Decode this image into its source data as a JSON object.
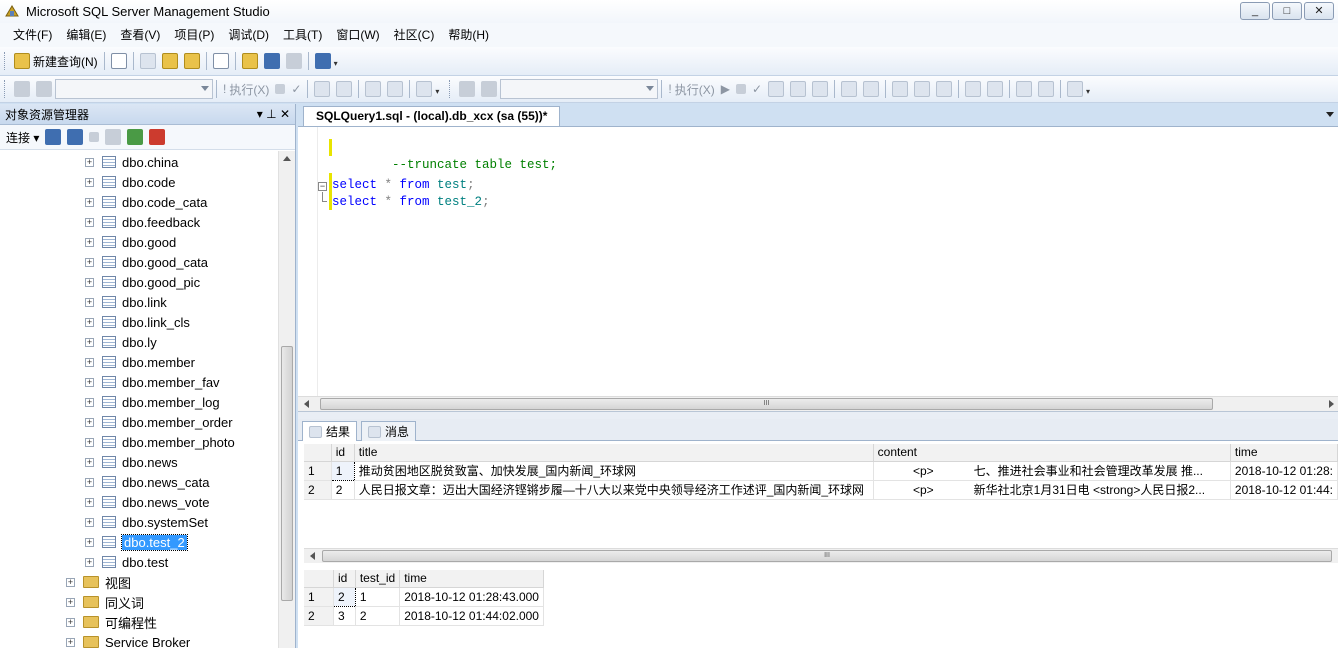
{
  "window": {
    "title": "Microsoft SQL Server Management Studio",
    "btn_min": "_",
    "btn_max": "□",
    "btn_close": "✕"
  },
  "menu": [
    "文件(F)",
    "编辑(E)",
    "查看(V)",
    "项目(P)",
    "调试(D)",
    "工具(T)",
    "窗口(W)",
    "社区(C)",
    "帮助(H)"
  ],
  "toolbar1": {
    "new_query": "新建查询(N)"
  },
  "toolbar2": {
    "execute_label": "执行(X)",
    "execute_label_2": "执行(X)"
  },
  "object_explorer": {
    "title": "对象资源管理器",
    "pin": "▾  ⊥  ✕",
    "connect_label": "连接 ▾",
    "tables": [
      "dbo.china",
      "dbo.code",
      "dbo.code_cata",
      "dbo.feedback",
      "dbo.good",
      "dbo.good_cata",
      "dbo.good_pic",
      "dbo.link",
      "dbo.link_cls",
      "dbo.ly",
      "dbo.member",
      "dbo.member_fav",
      "dbo.member_log",
      "dbo.member_order",
      "dbo.member_photo",
      "dbo.news",
      "dbo.news_cata",
      "dbo.news_vote",
      "dbo.systemSet",
      "dbo.test_2",
      "dbo.test"
    ],
    "selected_table": "dbo.test_2",
    "folders": [
      "视图",
      "同义词",
      "可编程性",
      "Service Broker"
    ]
  },
  "editor": {
    "tab_title": "SQLQuery1.sql - (local).db_xcx (sa (55))*",
    "line1_comment": "--truncate table test;",
    "line2": {
      "kw1": "select",
      "star": " * ",
      "kw2": "from",
      "table": " test",
      "end": ";"
    },
    "line3": {
      "kw1": "select",
      "star": " * ",
      "kw2": "from",
      "table": " test_2",
      "end": ";"
    }
  },
  "results": {
    "tab_results": "结果",
    "tab_messages": "消息",
    "grid1": {
      "columns": [
        "id",
        "title",
        "content",
        "time"
      ],
      "rows": [
        {
          "rownum": "1",
          "id": "1",
          "title": "推动贫困地区脱贫致富、加快发展_国内新闻_环球网",
          "content_tag": "<p>",
          "content_text": "七、推进社会事业和社会管理改革发展 推...",
          "time": "2018-10-12 01:28:"
        },
        {
          "rownum": "2",
          "id": "2",
          "title": "人民日报文章：迈出大国经济铿锵步履—十八大以来党中央领导经济工作述评_国内新闻_环球网",
          "content_tag": "<p>",
          "content_text": "新华社北京1月31日电 <strong>人民日报2...",
          "time": "2018-10-12 01:44:"
        }
      ]
    },
    "grid2": {
      "columns": [
        "id",
        "test_id",
        "time"
      ],
      "rows": [
        {
          "rownum": "1",
          "id": "2",
          "test_id": "1",
          "time": "2018-10-12 01:28:43.000"
        },
        {
          "rownum": "2",
          "id": "3",
          "test_id": "2",
          "time": "2018-10-12 01:44:02.000"
        }
      ]
    }
  }
}
